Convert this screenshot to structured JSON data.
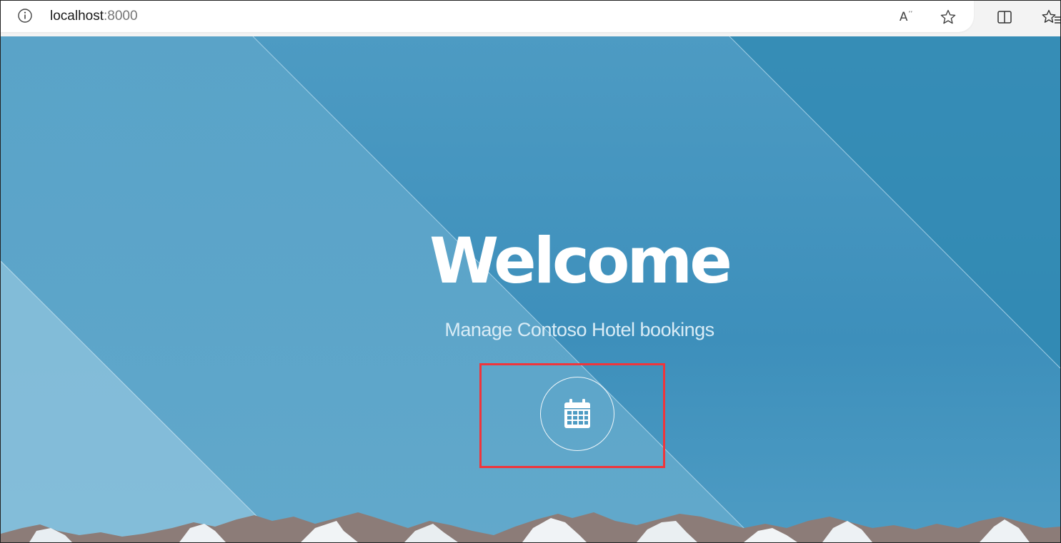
{
  "browser": {
    "url_host": "localhost",
    "url_port": ":8000",
    "read_aloud_label": "A"
  },
  "hero": {
    "title": "Welcome",
    "subtitle": "Manage Contoso Hotel bookings"
  },
  "icons": {
    "site_info": "info-icon",
    "read_aloud": "read-aloud-icon",
    "favorite": "star-icon",
    "split_screen": "split-screen-icon",
    "favorites": "favorites-icon",
    "bookings": "calendar-icon"
  },
  "colors": {
    "sky": "#4d9bc3",
    "highlight": "#f0353b",
    "text": "#ffffff"
  }
}
